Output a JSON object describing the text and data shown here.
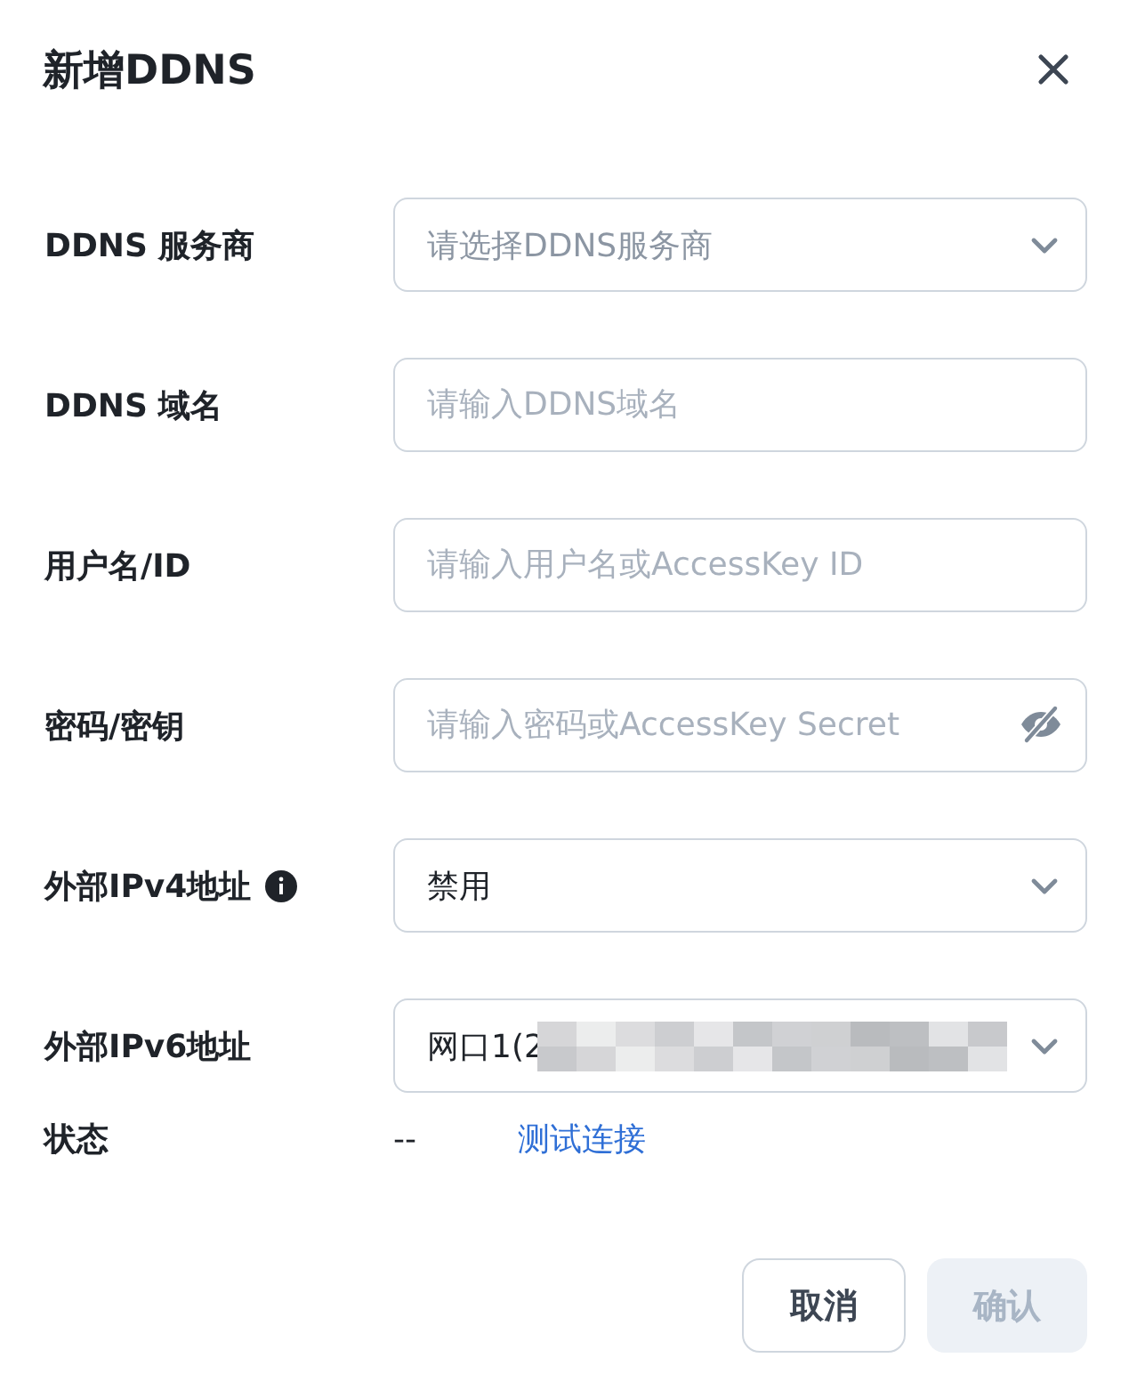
{
  "dialog": {
    "title": "新增DDNS"
  },
  "fields": [
    {
      "label": "DDNS 服务商",
      "kind": "select",
      "placeholder": "请选择DDNS服务商",
      "info": false
    },
    {
      "label": "DDNS 域名",
      "kind": "input",
      "placeholder": "请输入DDNS域名",
      "info": false
    },
    {
      "label": "用户名/ID",
      "kind": "input",
      "placeholder": "请输入用户名或AccessKey ID",
      "info": false
    },
    {
      "label": "密码/密钥",
      "kind": "password",
      "placeholder": "请输入密码或AccessKey Secret",
      "info": false
    },
    {
      "label": "外部IPv4地址",
      "kind": "select",
      "value": "禁用",
      "info": true
    },
    {
      "label": "外部IPv6地址",
      "kind": "select",
      "value": "网口1(2",
      "redacted": true,
      "info": false
    }
  ],
  "status": {
    "label": "状态",
    "value": "--",
    "link": "测试连接"
  },
  "buttons": [
    {
      "label": "取消",
      "disabled": false,
      "kind": "secondary"
    },
    {
      "label": "确认",
      "disabled": true,
      "kind": "primary"
    }
  ]
}
